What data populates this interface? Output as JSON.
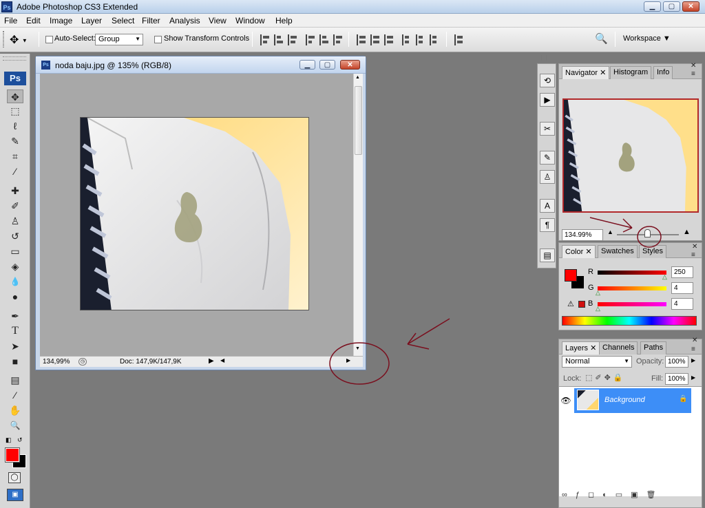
{
  "app": {
    "title": "Adobe Photoshop CS3 Extended",
    "logo": "Ps",
    "window_controls": {
      "minimize": "▁",
      "maximize": "▢",
      "close": "✕"
    }
  },
  "menu": [
    "File",
    "Edit",
    "Image",
    "Layer",
    "Select",
    "Filter",
    "Analysis",
    "View",
    "Window",
    "Help"
  ],
  "options": {
    "auto_select_label": "Auto-Select:",
    "auto_select_value": "Group",
    "show_transform_label": "Show Transform Controls",
    "workspace_label": "Workspace ▼"
  },
  "toolbox": {
    "logo": "Ps",
    "tools": [
      {
        "name": "move-tool",
        "glyph": "✥"
      },
      {
        "name": "marquee-tool",
        "glyph": "⬚"
      },
      {
        "name": "lasso-tool",
        "glyph": "ℓ"
      },
      {
        "name": "quick-select-tool",
        "glyph": "✎"
      },
      {
        "name": "crop-tool",
        "glyph": "⌗"
      },
      {
        "name": "eyedropper-tool",
        "glyph": "⁄"
      },
      {
        "name": "healing-brush-tool",
        "glyph": "✚"
      },
      {
        "name": "brush-tool",
        "glyph": "✐"
      },
      {
        "name": "clone-stamp-tool",
        "glyph": "♙"
      },
      {
        "name": "history-brush-tool",
        "glyph": "↺"
      },
      {
        "name": "eraser-tool",
        "glyph": "▭"
      },
      {
        "name": "paint-bucket-tool",
        "glyph": "◈"
      },
      {
        "name": "blur-tool",
        "glyph": "💧"
      },
      {
        "name": "dodge-tool",
        "glyph": "●"
      },
      {
        "name": "pen-tool",
        "glyph": "✒"
      },
      {
        "name": "type-tool",
        "glyph": "T"
      },
      {
        "name": "path-select-tool",
        "glyph": "➤"
      },
      {
        "name": "shape-tool",
        "glyph": "■"
      },
      {
        "name": "notes-tool",
        "glyph": "▤"
      },
      {
        "name": "eyedropper2-tool",
        "glyph": "⁄"
      },
      {
        "name": "hand-tool",
        "glyph": "✋"
      },
      {
        "name": "zoom-tool",
        "glyph": "🔍"
      }
    ],
    "foreground_color": "#ff0000",
    "background_color": "#000000"
  },
  "document": {
    "title": "noda baju.jpg @ 135% (RGB/8)",
    "zoom": "134,99%",
    "doc_info": "Doc: 147,9K/147,9K"
  },
  "navigator": {
    "tabs": [
      "Navigator",
      "Histogram",
      "Info"
    ],
    "zoom": "134.99%"
  },
  "color": {
    "tabs": [
      "Color",
      "Swatches",
      "Styles"
    ],
    "r_label": "R",
    "r_value": "250",
    "g_label": "G",
    "g_value": "4",
    "b_label": "B",
    "b_value": "4",
    "swatch": "#fa0404"
  },
  "layers": {
    "tabs": [
      "Layers",
      "Channels",
      "Paths"
    ],
    "blend_mode": "Normal",
    "opacity_label": "Opacity:",
    "opacity_value": "100%",
    "lock_label": "Lock:",
    "fill_label": "Fill:",
    "fill_value": "100%",
    "layer_name": "Background"
  },
  "colors": {
    "annotation": "#7a0f1e",
    "selection_blue": "#3d8ef7",
    "foreground_red": "#ff0000"
  }
}
